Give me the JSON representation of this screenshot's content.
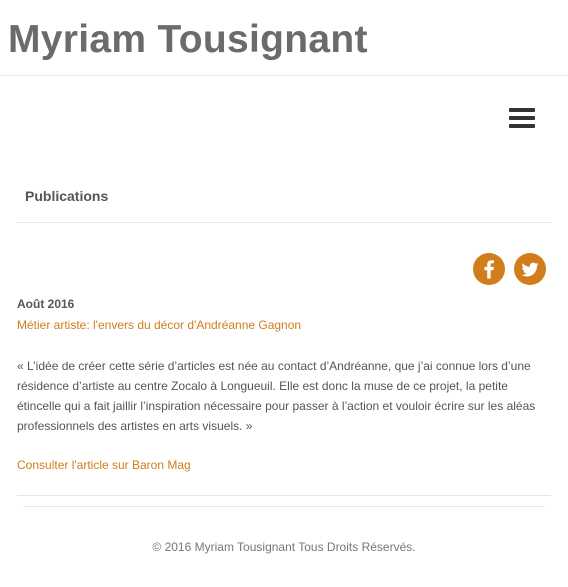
{
  "header": {
    "site_title": "Myriam Tousignant"
  },
  "nav": {
    "menu_icon": "hamburger-menu-icon"
  },
  "section": {
    "title": "Publications"
  },
  "social": {
    "facebook_icon": "facebook-icon",
    "twitter_icon": "twitter-icon",
    "accent_color": "#d17d1b"
  },
  "post": {
    "date": "Août 2016",
    "title_link": "Métier artiste: l'envers du décor d'Andréanne Gagnon",
    "quote": "« L’idée de créer cette série d’articles est née au contact d’Andréanne, que j’ai connue lors d’une résidence d’artiste au centre Zocalo à Longueuil. Elle est donc la muse de ce projet, la petite étincelle qui a fait jaillir l’inspiration nécessaire pour passer à l’action et vouloir écrire sur les aléas professionnels des artistes en arts visuels. »",
    "article_link": "Consulter l'article sur Baron Mag"
  },
  "footer": {
    "copyright": "© 2016 Myriam Tousignant Tous Droits Réservés."
  }
}
